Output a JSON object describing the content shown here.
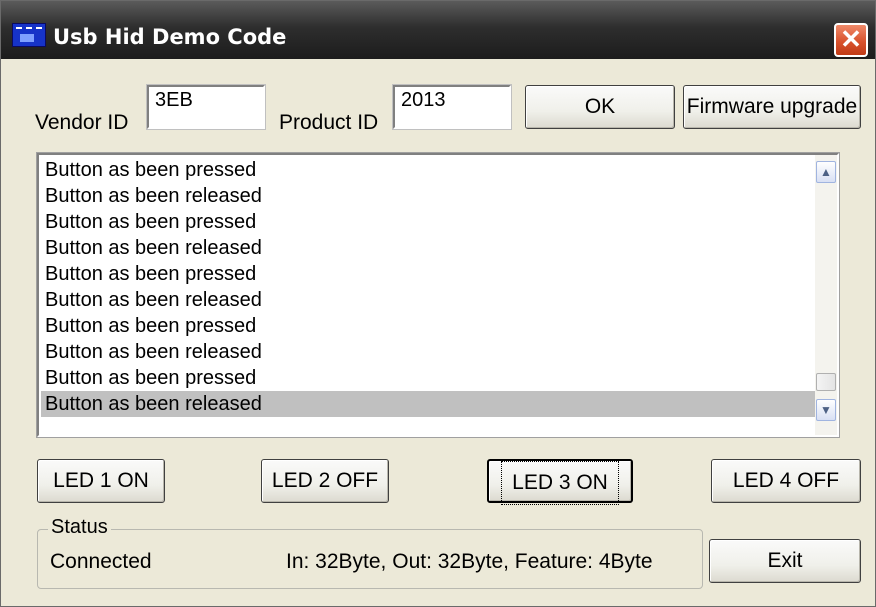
{
  "window": {
    "title": "Usb Hid Demo Code",
    "close_glyph": "✕"
  },
  "ids": {
    "vendor_label": "Vendor ID",
    "vendor_value": "3EB",
    "product_label": "Product ID",
    "product_value": "2013"
  },
  "buttons": {
    "ok": "OK",
    "firmware": "Firmware upgrade",
    "led1": "LED 1 ON",
    "led2": "LED 2 OFF",
    "led3": "LED 3 ON",
    "led4": "LED 4 OFF",
    "exit": "Exit"
  },
  "log": {
    "items": [
      "Button as been pressed",
      "Button as been released",
      "Button as been pressed",
      "Button as been released",
      "Button as been pressed",
      "Button as been released",
      "Button as been pressed",
      "Button as been released",
      "Button as been pressed",
      "Button as been released"
    ],
    "selected_index": 9
  },
  "status": {
    "legend": "Status",
    "connection": "Connected",
    "info": "In: 32Byte, Out: 32Byte, Feature: 4Byte"
  },
  "icons": {
    "scroll_up": "▲",
    "scroll_down": "▼"
  },
  "colors": {
    "titlebar": "#2e2e2e",
    "close_button": "#d9532e",
    "selection": "#c0c0c0",
    "window_bg": "#ece9d8"
  }
}
